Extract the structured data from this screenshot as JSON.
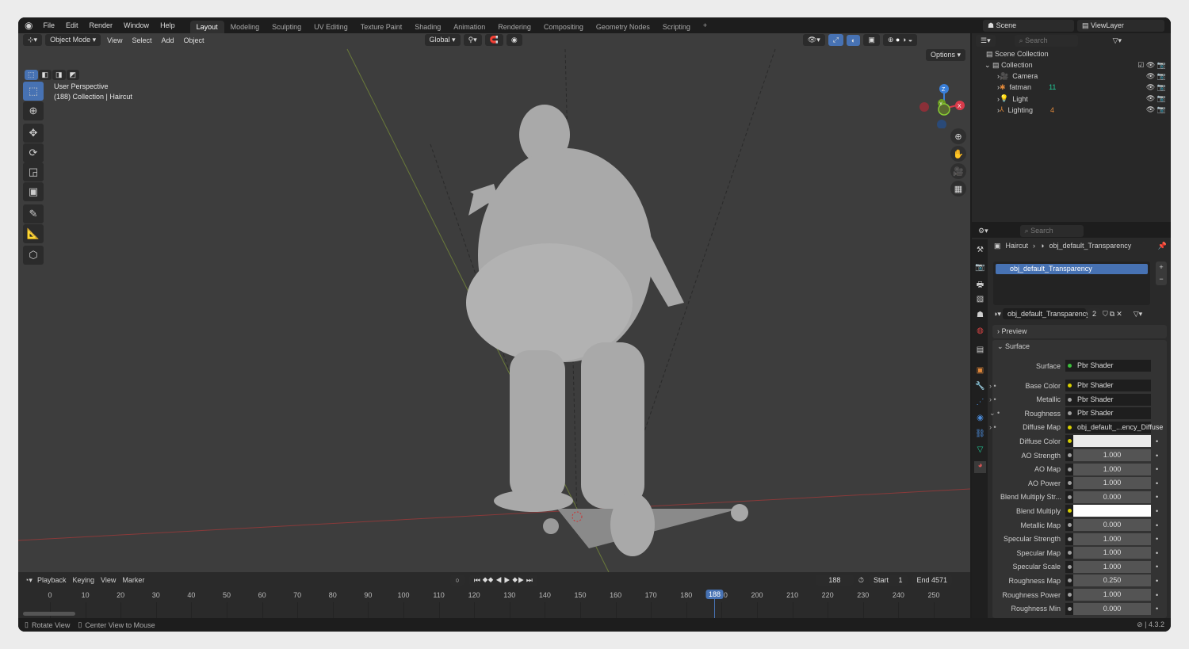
{
  "menu": [
    "File",
    "Edit",
    "Render",
    "Window",
    "Help"
  ],
  "workspaces": [
    "Layout",
    "Modeling",
    "Sculpting",
    "UV Editing",
    "Texture Paint",
    "Shading",
    "Animation",
    "Rendering",
    "Compositing",
    "Geometry Nodes",
    "Scripting"
  ],
  "workspace_add": "+",
  "viewport": {
    "mode": "Object Mode",
    "menus": [
      "View",
      "Select",
      "Add",
      "Object"
    ],
    "orientation": "Global",
    "options": "Options",
    "overlay_title": "User Perspective",
    "overlay_info": "(188) Collection | Haircut",
    "axes": {
      "x": "X",
      "y": "Y",
      "z": "Z"
    }
  },
  "outliner": {
    "scene": "Scene",
    "view_layer": "ViewLayer",
    "search_placeholder": "Search",
    "scene_collection": "Scene Collection",
    "collection": "Collection",
    "items": [
      {
        "name": "Camera",
        "color": "#e0883a"
      },
      {
        "name": "fatman",
        "color": "#e0883a"
      },
      {
        "name": "Light",
        "color": "#e0883a"
      },
      {
        "name": "Lighting",
        "color": "#e0883a"
      }
    ],
    "badge_fatman": "11",
    "badge_lighting": "4"
  },
  "properties": {
    "search_placeholder": "Search",
    "breadcrumb_object": "Haircut",
    "breadcrumb_material": "obj_default_Transparency",
    "slot": "obj_default_Transparency",
    "material_name": "obj_default_Transparency",
    "users": "2",
    "preview": "Preview",
    "surface_panel": "Surface",
    "rows": [
      {
        "label": "Surface",
        "value": "Pbr Shader",
        "type": "shader",
        "dot": "#3cbf3c"
      },
      {
        "label": "Base Color",
        "value": "Pbr Shader",
        "type": "shader",
        "dot": "#d8d000",
        "expand": ">"
      },
      {
        "label": "Metallic",
        "value": "Pbr Shader",
        "type": "shader",
        "dot": "#a0a0a0",
        "expand": ">"
      },
      {
        "label": "Roughness",
        "value": "Pbr Shader",
        "type": "shader",
        "dot": "#a0a0a0",
        "expand": "v"
      },
      {
        "label": "Diffuse Map",
        "value": "obj_default_...ency_Diffuse",
        "type": "shader",
        "dot": "#d8d000",
        "expand": ">"
      },
      {
        "label": "Diffuse Color",
        "value": "",
        "type": "col",
        "dot": "#d8d000"
      },
      {
        "label": "AO Strength",
        "value": "1.000",
        "type": "num",
        "dot": "#a0a0a0"
      },
      {
        "label": "AO Map",
        "value": "1.000",
        "type": "num",
        "dot": "#a0a0a0"
      },
      {
        "label": "AO Power",
        "value": "1.000",
        "type": "num",
        "dot": "#a0a0a0"
      },
      {
        "label": "Blend Multiply Str...",
        "value": "0.000",
        "type": "num",
        "dot": "#a0a0a0"
      },
      {
        "label": "Blend Multiply",
        "value": "",
        "type": "white",
        "dot": "#d8d000"
      },
      {
        "label": "Metallic Map",
        "value": "0.000",
        "type": "num",
        "dot": "#a0a0a0"
      },
      {
        "label": "Specular Strength",
        "value": "1.000",
        "type": "num",
        "dot": "#a0a0a0"
      },
      {
        "label": "Specular Map",
        "value": "1.000",
        "type": "num",
        "dot": "#a0a0a0"
      },
      {
        "label": "Specular Scale",
        "value": "1.000",
        "type": "num",
        "dot": "#a0a0a0"
      },
      {
        "label": "Roughness Map",
        "value": "0.250",
        "type": "num",
        "dot": "#a0a0a0"
      },
      {
        "label": "Roughness Power",
        "value": "1.000",
        "type": "num",
        "dot": "#a0a0a0"
      },
      {
        "label": "Roughness Min",
        "value": "0.000",
        "type": "num",
        "dot": "#a0a0a0"
      }
    ]
  },
  "timeline": {
    "menus": [
      "Playback",
      "Keying",
      "View",
      "Marker"
    ],
    "current_frame": "188",
    "start_label": "Start",
    "start": "1",
    "end_label": "End",
    "end": "4571",
    "ticks": [
      0,
      10,
      20,
      30,
      40,
      50,
      60,
      70,
      80,
      90,
      100,
      110,
      120,
      130,
      140,
      150,
      160,
      170,
      180,
      190,
      200,
      210,
      220,
      230,
      240,
      250
    ],
    "playhead": 188
  },
  "status": {
    "hint1": "Rotate View",
    "hint2": "Center View to Mouse",
    "version": "4.3.2"
  },
  "accent": "#4772b3"
}
